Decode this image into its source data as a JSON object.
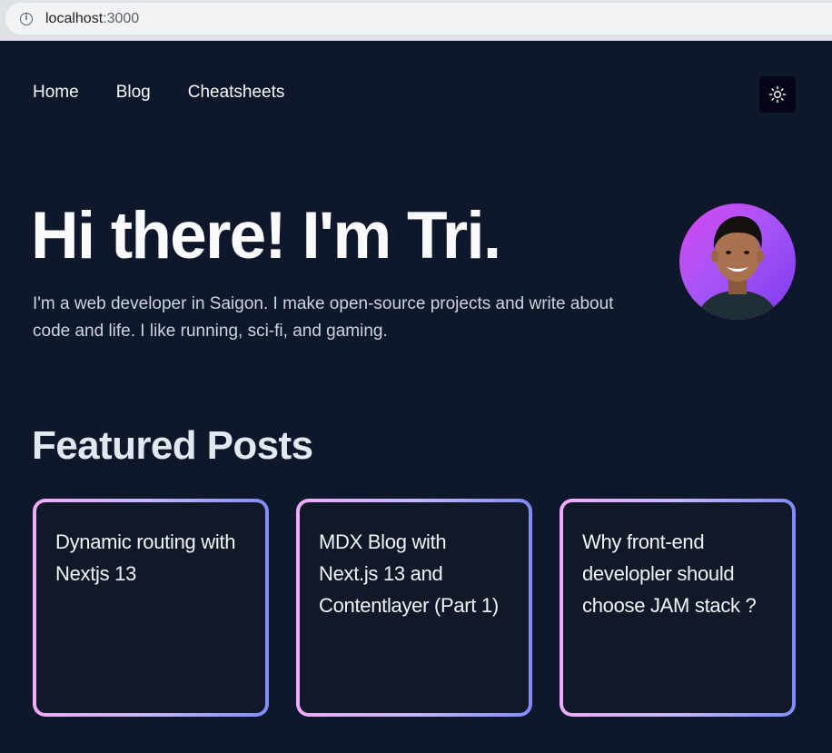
{
  "browser": {
    "url_host": "localhost",
    "url_port": ":3000",
    "info_icon": "info-icon"
  },
  "nav": {
    "items": [
      {
        "label": "Home"
      },
      {
        "label": "Blog"
      },
      {
        "label": "Cheatsheets"
      }
    ],
    "theme_toggle_icon": "sun-icon"
  },
  "hero": {
    "title": "Hi there! I'm Tri.",
    "description": "I'm a web developer in Saigon. I make open-source projects and write about code and life. I like running, sci-fi, and gaming.",
    "avatar_icon": "avatar-photo"
  },
  "featured": {
    "heading": "Featured Posts",
    "posts": [
      {
        "title": "Dynamic routing with Nextjs 13"
      },
      {
        "title": "MDX Blog with Next.js 13 and Contentlayer (Part 1)"
      },
      {
        "title": "Why front-end developler should choose JAM stack ?"
      }
    ]
  },
  "colors": {
    "background": "#0f172a",
    "card_border_start": "#f0abfc",
    "card_border_end": "#818cf8",
    "avatar_bg": "#a855f7"
  }
}
